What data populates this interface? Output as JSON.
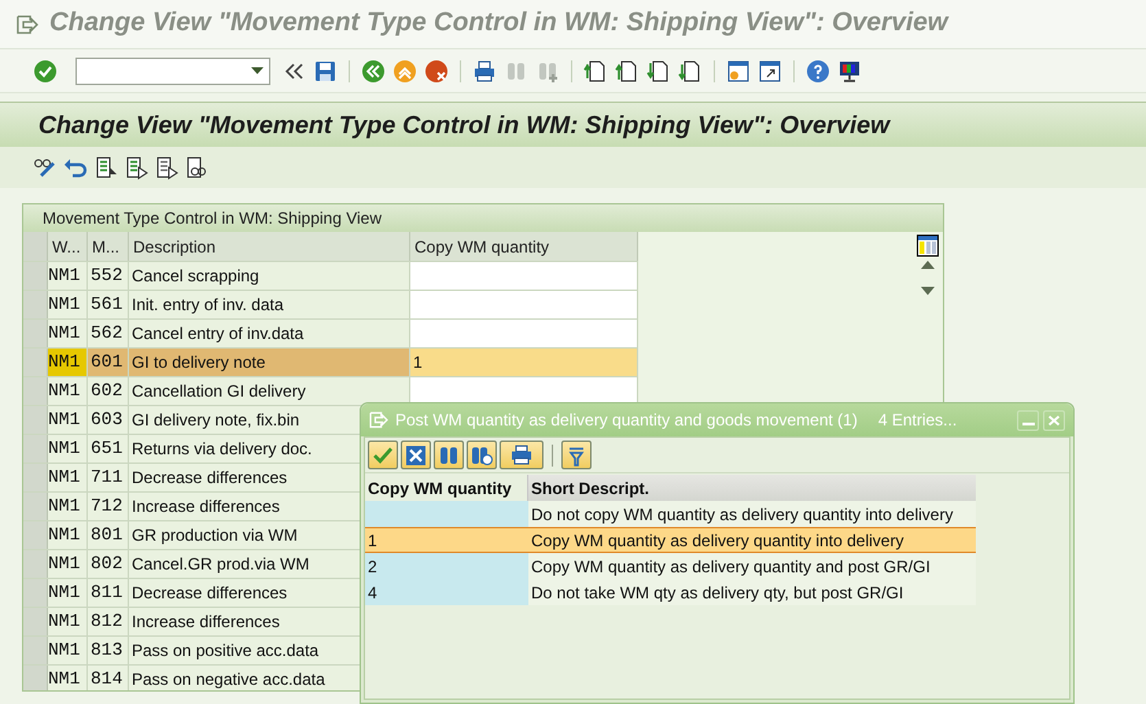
{
  "window": {
    "title": "Change View \"Movement Type Control in WM: Shipping View\": Overview"
  },
  "header": {
    "title": "Change View \"Movement Type Control in WM: Shipping View\": Overview"
  },
  "table": {
    "caption": "Movement Type Control in WM: Shipping View",
    "columns": [
      "W...",
      "M...",
      "Description",
      "Copy WM quantity"
    ],
    "rows": [
      {
        "w": "NM1",
        "m": "552",
        "description": "Cancel scrapping",
        "selected": false
      },
      {
        "w": "NM1",
        "m": "561",
        "description": "Init. entry of inv. data",
        "selected": false
      },
      {
        "w": "NM1",
        "m": "562",
        "description": "Cancel entry of inv.data",
        "selected": false
      },
      {
        "w": "NM1",
        "m": "601",
        "description": "GI to delivery note",
        "copy": "1",
        "selected": true
      },
      {
        "w": "NM1",
        "m": "602",
        "description": "Cancellation GI delivery",
        "selected": false
      },
      {
        "w": "NM1",
        "m": "603",
        "description": "GI delivery note, fix.bin",
        "selected": false
      },
      {
        "w": "NM1",
        "m": "651",
        "description": "Returns via delivery doc.",
        "selected": false
      },
      {
        "w": "NM1",
        "m": "711",
        "description": "Decrease differences",
        "selected": false
      },
      {
        "w": "NM1",
        "m": "712",
        "description": "Increase differences",
        "selected": false
      },
      {
        "w": "NM1",
        "m": "801",
        "description": "GR production via WM",
        "selected": false
      },
      {
        "w": "NM1",
        "m": "802",
        "description": "Cancel.GR prod.via WM",
        "selected": false
      },
      {
        "w": "NM1",
        "m": "811",
        "description": "Decrease differences",
        "selected": false
      },
      {
        "w": "NM1",
        "m": "812",
        "description": "Increase differences",
        "selected": false
      },
      {
        "w": "NM1",
        "m": "813",
        "description": "Pass on positive acc.data",
        "selected": false
      },
      {
        "w": "NM1",
        "m": "814",
        "description": "Pass on negative acc.data",
        "selected": false
      }
    ]
  },
  "popup": {
    "title": "Post WM quantity as delivery quantity and goods movement (1)",
    "entries": "4 Entries...",
    "columns": [
      "Copy WM quantity",
      "Short Descript."
    ],
    "rows": [
      {
        "description": "Do not copy WM quantity as delivery quantity into delivery",
        "selected": false
      },
      {
        "value": "1",
        "description": "Copy WM quantity as delivery quantity into delivery",
        "selected": true
      },
      {
        "value": "2",
        "description": "Copy WM quantity as delivery quantity and post GR/GI",
        "selected": false
      },
      {
        "value": "4",
        "description": "Do not take WM qty as delivery qty, but post GR/GI",
        "selected": false
      }
    ]
  }
}
